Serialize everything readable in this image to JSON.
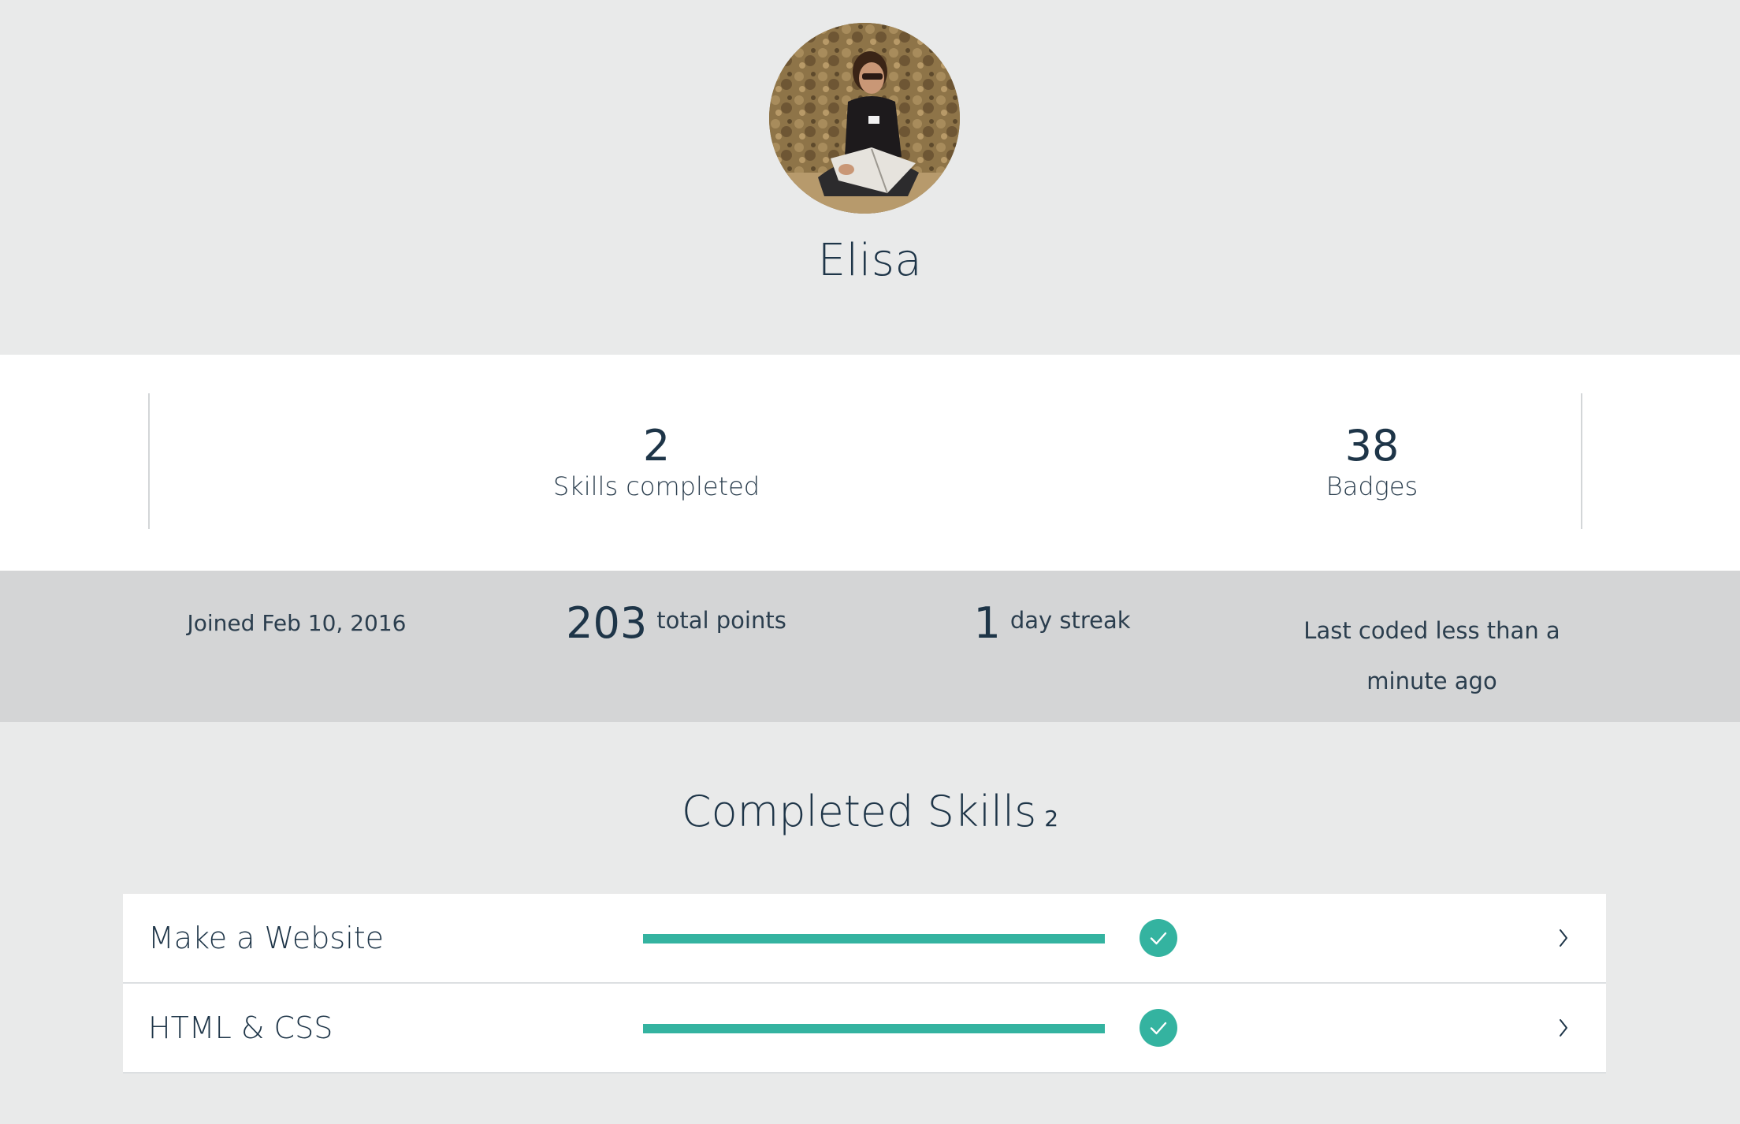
{
  "profile": {
    "name": "Elisa"
  },
  "primary_stats": {
    "skills_completed": {
      "value": "2",
      "label": "Skills completed"
    },
    "badges": {
      "value": "38",
      "label": "Badges"
    }
  },
  "secondary_stats": {
    "joined": "Joined Feb 10, 2016",
    "total_points": {
      "value": "203",
      "label": "total points"
    },
    "streak": {
      "value": "1",
      "label": "day streak"
    },
    "last_coded": "Last coded less than a minute ago"
  },
  "completed_skills": {
    "title": "Completed Skills",
    "count": "2",
    "items": [
      {
        "name": "Make a Website",
        "progress": 1.0,
        "completed": true
      },
      {
        "name": "HTML & CSS",
        "progress": 1.0,
        "completed": true
      }
    ]
  },
  "colors": {
    "accent": "#34b3a0",
    "text": "#1e3548",
    "header_bg": "#e9eaea",
    "band_bg": "#d4d5d6"
  },
  "icons": {
    "completed": "check-circle-icon",
    "row_action": "chevron-right-icon"
  }
}
